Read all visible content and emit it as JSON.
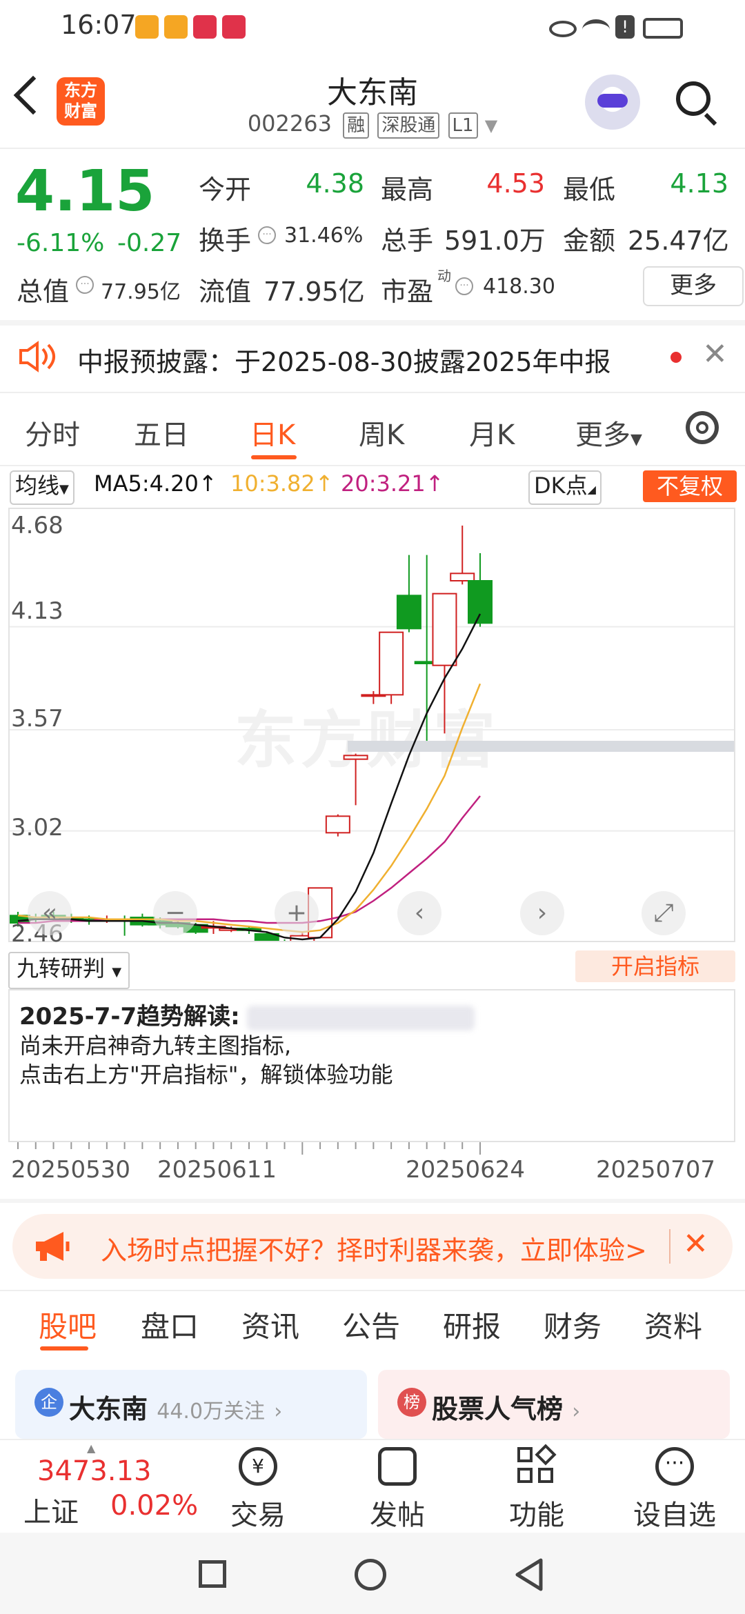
{
  "status_bar": {
    "time": "16:07"
  },
  "header": {
    "logo_text": "东方财富",
    "stock_name": "大东南",
    "stock_code": "002263",
    "tags": [
      "融",
      "深股通",
      "L1"
    ]
  },
  "quote": {
    "price": "4.15",
    "change_pct": "-6.11%",
    "change_abs": "-0.27",
    "rows": [
      {
        "l1": "今开",
        "v1": "4.38",
        "l2": "最高",
        "v2": "4.53",
        "l3": "最低",
        "v3": "4.13"
      },
      {
        "l1": "换手",
        "v1": "31.46%",
        "l2": "总手",
        "v2": "591.0万",
        "l3": "金额",
        "v3": "25.47亿"
      },
      {
        "l1": "总值",
        "v1": "77.95亿",
        "l2": "流值",
        "v2": "77.95亿",
        "l3": "市盈",
        "v3": "418.30"
      }
    ],
    "pe_superscript": "动",
    "more_label": "更多"
  },
  "notice": {
    "text": "中报预披露：于2025-08-30披露2025年中报"
  },
  "chart_tabs": [
    "分时",
    "五日",
    "日K",
    "周K",
    "月K",
    "更多"
  ],
  "chart_header": {
    "indicator": "均线",
    "ma5": "MA5:4.20",
    "ma10": "10:3.82",
    "ma20": "20:3.21",
    "dk": "DK点",
    "adjust": "不复权",
    "colors": {
      "ma5": "#111111",
      "ma10": "#f0b030",
      "ma20": "#c0207f",
      "up": "#d02020",
      "down": "#109a20"
    }
  },
  "watermark": "东方财富",
  "chart_data": {
    "type": "candlestick",
    "y_ticks": [
      "4.68",
      "4.13",
      "3.57",
      "3.02",
      "2.46"
    ],
    "ylim": [
      2.46,
      4.68
    ],
    "x_ticks": [
      "20250530",
      "20250611",
      "20250624",
      "20250707"
    ],
    "candles": [
      {
        "o": 2.56,
        "c": 2.52,
        "h": 2.58,
        "l": 2.5
      },
      {
        "o": 2.55,
        "c": 2.54,
        "h": 2.57,
        "l": 2.52
      },
      {
        "o": 2.56,
        "c": 2.55,
        "h": 2.58,
        "l": 2.53
      },
      {
        "o": 2.55,
        "c": 2.54,
        "h": 2.57,
        "l": 2.52
      },
      {
        "o": 2.54,
        "c": 2.53,
        "h": 2.56,
        "l": 2.51
      },
      {
        "o": 2.54,
        "c": 2.54,
        "h": 2.56,
        "l": 2.52
      },
      {
        "o": 2.54,
        "c": 2.53,
        "h": 2.56,
        "l": 2.45
      },
      {
        "o": 2.55,
        "c": 2.51,
        "h": 2.57,
        "l": 2.5
      },
      {
        "o": 2.53,
        "c": 2.51,
        "h": 2.55,
        "l": 2.49
      },
      {
        "o": 2.52,
        "c": 2.5,
        "h": 2.54,
        "l": 2.49
      },
      {
        "o": 2.51,
        "c": 2.47,
        "h": 2.52,
        "l": 2.46
      },
      {
        "o": 2.5,
        "c": 2.5,
        "h": 2.53,
        "l": 2.46
      },
      {
        "o": 2.48,
        "c": 2.49,
        "h": 2.5,
        "l": 2.47
      },
      {
        "o": 2.49,
        "c": 2.48,
        "h": 2.5,
        "l": 2.46
      },
      {
        "o": 2.46,
        "c": 2.42,
        "h": 2.47,
        "l": 2.41
      },
      {
        "o": 2.41,
        "c": 2.4,
        "h": 2.43,
        "l": 2.39
      },
      {
        "o": 2.39,
        "c": 2.45,
        "h": 2.47,
        "l": 2.36
      },
      {
        "o": 2.44,
        "c": 2.71,
        "h": 2.71,
        "l": 2.44
      },
      {
        "o": 3.01,
        "c": 3.1,
        "h": 3.11,
        "l": 2.99
      },
      {
        "o": 3.41,
        "c": 3.43,
        "h": 3.44,
        "l": 3.16
      },
      {
        "o": 3.76,
        "c": 3.76,
        "h": 3.78,
        "l": 3.71
      },
      {
        "o": 3.76,
        "c": 4.1,
        "h": 4.1,
        "l": 3.71
      },
      {
        "o": 4.3,
        "c": 4.12,
        "h": 4.52,
        "l": 4.1
      },
      {
        "o": 3.94,
        "c": 3.93,
        "h": 4.52,
        "l": 3.51
      },
      {
        "o": 3.92,
        "c": 4.31,
        "h": 4.31,
        "l": 3.55
      },
      {
        "o": 4.38,
        "c": 4.42,
        "h": 4.68,
        "l": 4.36
      },
      {
        "o": 4.38,
        "c": 4.15,
        "h": 4.53,
        "l": 4.13
      }
    ],
    "ma5": [
      2.53,
      2.54,
      2.54,
      2.54,
      2.53,
      2.53,
      2.53,
      2.53,
      2.52,
      2.52,
      2.51,
      2.5,
      2.49,
      2.48,
      2.47,
      2.44,
      2.43,
      2.44,
      2.54,
      2.69,
      2.9,
      3.17,
      3.43,
      3.66,
      3.85,
      4.01,
      4.2
    ],
    "ma10": [
      2.56,
      2.55,
      2.55,
      2.55,
      2.55,
      2.54,
      2.54,
      2.54,
      2.54,
      2.53,
      2.53,
      2.52,
      2.51,
      2.5,
      2.49,
      2.48,
      2.47,
      2.48,
      2.52,
      2.59,
      2.7,
      2.83,
      2.98,
      3.14,
      3.32,
      3.58,
      3.82
    ],
    "ma20": [
      2.52,
      2.52,
      2.53,
      2.53,
      2.53,
      2.54,
      2.54,
      2.54,
      2.54,
      2.54,
      2.54,
      2.54,
      2.53,
      2.53,
      2.52,
      2.52,
      2.52,
      2.53,
      2.55,
      2.58,
      2.64,
      2.71,
      2.79,
      2.87,
      2.96,
      3.09,
      3.21
    ],
    "dk_band": [
      3.45,
      3.51
    ]
  },
  "nine_turn": {
    "label": "九转研判",
    "enable": "开启指标",
    "title": "2025-7-7趋势解读:",
    "line1": "尚未开启神奇九转主图指标,",
    "line2": "点击右上方\"开启指标\"，解锁体验功能"
  },
  "promo": {
    "text": "入场时点把握不好？择时利器来袭，立即体验>"
  },
  "bottom_tabs": [
    "股吧",
    "盘口",
    "资讯",
    "公告",
    "研报",
    "财务",
    "资料"
  ],
  "cards": [
    {
      "icon_text": "企",
      "title": "大东南",
      "sub": "44.0万关注"
    },
    {
      "icon_text": "榜",
      "title": "股票人气榜",
      "sub": ""
    }
  ],
  "bottom_bar": {
    "index_value": "3473.13",
    "index_name": "上证",
    "index_pct": "0.02%",
    "buttons": [
      "交易",
      "发帖",
      "功能",
      "设自选"
    ]
  }
}
